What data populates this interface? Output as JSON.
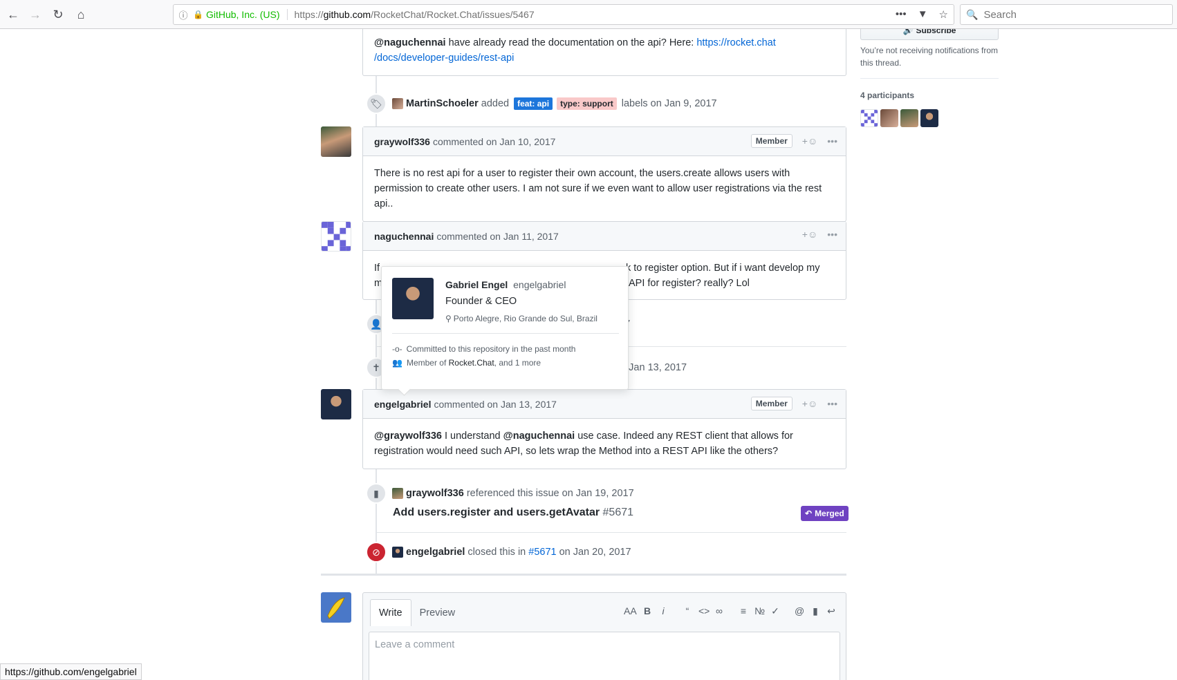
{
  "browser": {
    "identity": "GitHub, Inc. (US)",
    "url_prefix": "https://",
    "url_domain": "github.com",
    "url_path": "/RocketChat/Rocket.Chat/issues/5467",
    "search_placeholder": "Search",
    "status_url": "https://github.com/engelgabriel"
  },
  "sidebar": {
    "subscribe_label": "Subscribe",
    "notif_text": "You’re not receiving notifications from this thread.",
    "participants_title": "4 participants"
  },
  "top_comment": {
    "mention": "@naguchennai",
    "text": " have already read the documentation on the api? Here: ",
    "link": "https://rocket.chat/docs/developer-guides/rest-api",
    "link_line1": "https://rocket.chat",
    "link_line2": "/docs/developer-guides/rest-api"
  },
  "label_event": {
    "actor": "MartinSchoeler",
    "action": "added",
    "label1": "feat: api",
    "label1_color": "#0e8a16",
    "label2": "type: support",
    "label2_color": "#f9c9c9",
    "suffix": "labels on Jan 9, 2017"
  },
  "comment1": {
    "author": "graywolf336",
    "meta": "commented on Jan 10, 2017",
    "badge": "Member",
    "body": "There is no rest api for a user to register their own account, the users.create allows users with permission to create other users. I am not sure if we even want to allow user registrations via the rest api.."
  },
  "comment2": {
    "author": "naguchennai",
    "meta": "commented on Jan 11, 2017",
    "body_left_1": "If",
    "body_left_2": "m",
    "body_right_1": "k to register option. But if i want develop my",
    "body_right_2": "API for register? really? Lol"
  },
  "hidden_events": {
    "date1_fragment": "017",
    "date2_fragment": "on Jan 13, 2017"
  },
  "hovercard": {
    "name": "Gabriel Engel",
    "login": "engelgabriel",
    "title": "Founder & CEO",
    "location": "Porto Alegre, Rio Grande do Sul, Brazil",
    "committed": "Committed to this repository in the past month",
    "member_prefix": "Member of ",
    "member_org": "Rocket.Chat",
    "member_suffix": ", and 1 more"
  },
  "comment3": {
    "author": "engelgabriel",
    "meta": "commented on Jan 13, 2017",
    "badge": "Member",
    "mention1": "@graywolf336",
    "text1": " I understand ",
    "mention2": "@naguchennai",
    "text2": " use case. Indeed any REST client that allows for registration would need such API, so lets wrap the Method into a REST API like the others?"
  },
  "ref_event": {
    "actor": "graywolf336",
    "text": "referenced this issue on Jan 19, 2017",
    "pr_title": "Add users.register and users.getAvatar",
    "pr_number": "#5671",
    "merged": "Merged"
  },
  "closed_event": {
    "actor": "engelgabriel",
    "text_pre": "closed this in",
    "pr_link": "#5671",
    "text_post": "on Jan 20, 2017"
  },
  "composer": {
    "tab_write": "Write",
    "tab_preview": "Preview",
    "placeholder": "Leave a comment"
  },
  "colors": {
    "link": "#0366d6",
    "merged": "#6f42c1",
    "closed": "#cb2431"
  }
}
